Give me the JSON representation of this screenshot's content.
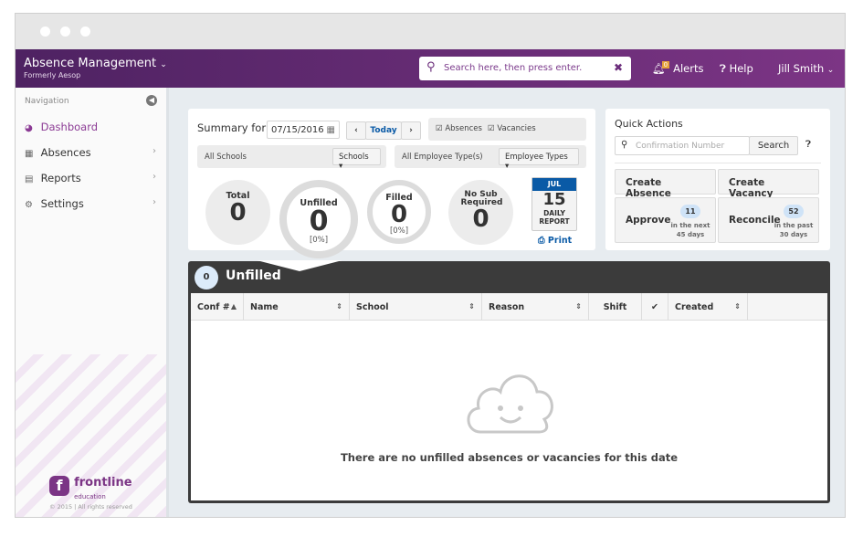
{
  "header": {
    "app_title": "Absence Management",
    "app_subtitle": "Formerly Aesop",
    "search_placeholder": "Search here, then press enter.",
    "alerts_label": "Alerts",
    "alerts_count": "0",
    "help_label": "Help",
    "user_name": "Jill Smith"
  },
  "sidebar": {
    "heading": "Navigation",
    "items": [
      {
        "label": "Dashboard",
        "icon": "dashboard-icon",
        "active": true
      },
      {
        "label": "Absences",
        "icon": "calendar-icon"
      },
      {
        "label": "Reports",
        "icon": "chart-icon"
      },
      {
        "label": "Settings",
        "icon": "gear-icon"
      }
    ],
    "logo_text": "frontline",
    "logo_sub": "education",
    "copyright": "© 2015 | All rights reserved"
  },
  "summary": {
    "label": "Summary for:",
    "date": "07/15/2016",
    "today": "Today",
    "absences": "Absences",
    "vacancies": "Vacancies",
    "schools_value": "All Schools",
    "schools_btn": "Schools",
    "emp_value": "All Employee Type(s)",
    "emp_btn": "Employee Types",
    "stats": [
      {
        "label": "Total",
        "value": "0"
      },
      {
        "label": "Unfilled",
        "value": "0",
        "pct": "[0%]"
      },
      {
        "label": "Filled",
        "value": "0",
        "pct": "[0%]"
      },
      {
        "label": "No Sub Required",
        "value": "0"
      }
    ],
    "report": {
      "month": "JUL",
      "day": "15",
      "line1": "DAILY",
      "line2": "REPORT",
      "print": "Print"
    }
  },
  "quick": {
    "title": "Quick Actions",
    "placeholder": "Confirmation Number",
    "search": "Search",
    "create_absence": "Create Absence",
    "create_vacancy": "Create Vacancy",
    "approve": "Approve",
    "approve_count": "11",
    "approve_note1": "in the next",
    "approve_note2": "45 days",
    "reconcile": "Reconcile",
    "reconcile_count": "52",
    "reconcile_note1": "in the past",
    "reconcile_note2": "30 days"
  },
  "panel": {
    "count": "0",
    "title": "Unfilled",
    "columns": [
      "Conf #",
      "Name",
      "School",
      "Reason",
      "Shift",
      "✔",
      "Created"
    ],
    "empty": "There are no unfilled absences or vacancies for this date"
  },
  "colors": {
    "brand": "#6b2d7b",
    "accent": "#0a5aa6"
  }
}
